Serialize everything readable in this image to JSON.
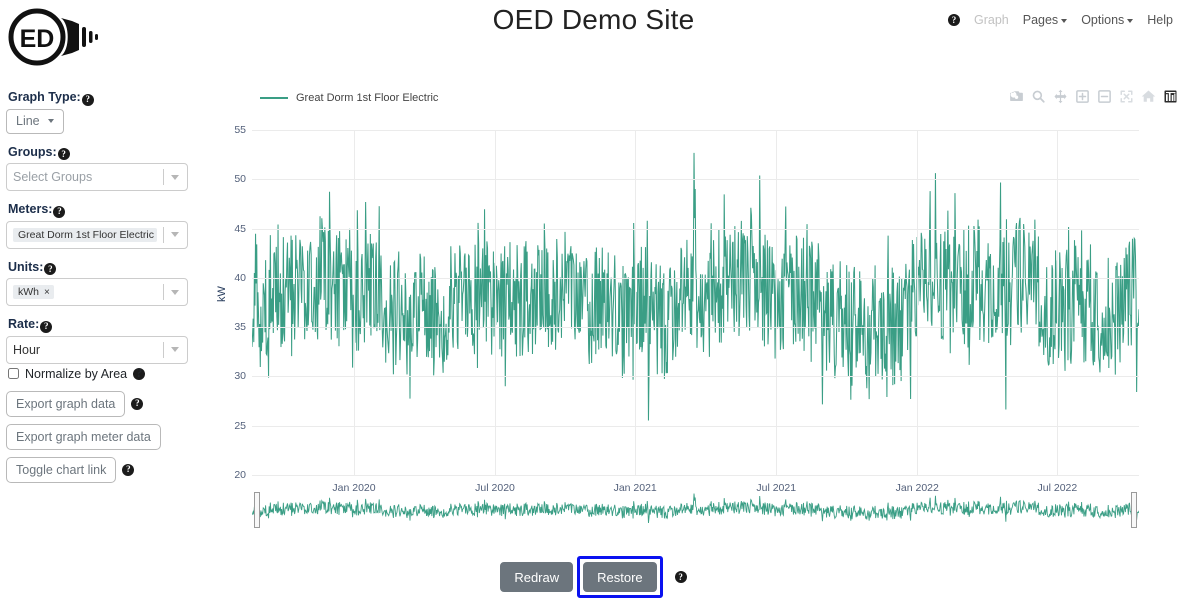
{
  "header": {
    "title": "OED Demo Site",
    "logo_text": "ED",
    "logo_name": "oed-lightbulb-logo",
    "nav": [
      {
        "label": "Graph",
        "icon": "help-circle-icon",
        "has_caret": false,
        "disabled": true
      },
      {
        "label": "Pages",
        "has_caret": true,
        "disabled": false
      },
      {
        "label": "Options",
        "has_caret": true,
        "disabled": false
      },
      {
        "label": "Help",
        "has_caret": false,
        "disabled": false
      }
    ]
  },
  "sidebar": {
    "graph_type": {
      "label": "Graph Type:",
      "value": "Line"
    },
    "groups": {
      "label": "Groups:",
      "placeholder": "Select Groups",
      "chips": []
    },
    "meters": {
      "label": "Meters:",
      "chips": [
        "Great Dorm 1st Floor Electric"
      ]
    },
    "units": {
      "label": "Units:",
      "chips": [
        "kWh"
      ]
    },
    "rate": {
      "label": "Rate:",
      "value": "Hour"
    },
    "normalize": {
      "label": "Normalize by Area",
      "checked": false
    },
    "buttons": [
      {
        "label": "Export graph data",
        "help": true
      },
      {
        "label": "Export graph meter data",
        "help": false
      },
      {
        "label": "Toggle chart link",
        "help": true
      }
    ],
    "remove_chip_glyph": "×"
  },
  "chart_data": {
    "type": "line",
    "title": "",
    "xlabel": "",
    "ylabel": "kW",
    "legend": [
      {
        "name": "Great Dorm 1st Floor Electric",
        "color": "#3a9e85"
      }
    ],
    "legend_position": "top-left",
    "grid": true,
    "ylim": [
      20,
      55
    ],
    "yticks": [
      20,
      25,
      30,
      35,
      40,
      45,
      50,
      55
    ],
    "xticks": [
      "Jan 2020",
      "Jul 2020",
      "Jan 2021",
      "Jul 2021",
      "Jan 2022",
      "Jul 2022"
    ],
    "xtick_positions_pct": [
      11.5,
      27.4,
      43.2,
      59.1,
      75.0,
      90.8
    ],
    "x_range": [
      "Oct 2019",
      "Nov 2022"
    ],
    "series": [
      {
        "name": "Great Dorm 1st Floor Electric",
        "color": "#3a9e85",
        "unit": "kW",
        "sampling": "hourly",
        "value_min": 21.5,
        "value_max": 54.0,
        "value_mean": 38.0,
        "description": "Dense hourly electricity demand oscillating roughly between 22 and 54 kW with a mean near 38 kW across Oct 2019 - Nov 2022."
      }
    ],
    "rangeslider": {
      "visible": true,
      "selected_min_pct": 0,
      "selected_max_pct": 100
    }
  },
  "modebar": [
    "camera-icon",
    "zoom-magnifier-icon",
    "pan-move-icon",
    "zoom-in-icon",
    "zoom-out-icon",
    "autoscale-icon",
    "reset-home-icon",
    "toggle-spikelines-icon"
  ],
  "footer": {
    "redraw_label": "Redraw",
    "restore_label": "Restore",
    "restore_focused": true,
    "help": true
  },
  "colors": {
    "series": "#3a9e85",
    "grid": "#ebebeb",
    "tick_text": "#53607a",
    "button_bg": "#6c757d",
    "focus_ring": "#0a12f0",
    "label_text": "#1c2e4a"
  }
}
